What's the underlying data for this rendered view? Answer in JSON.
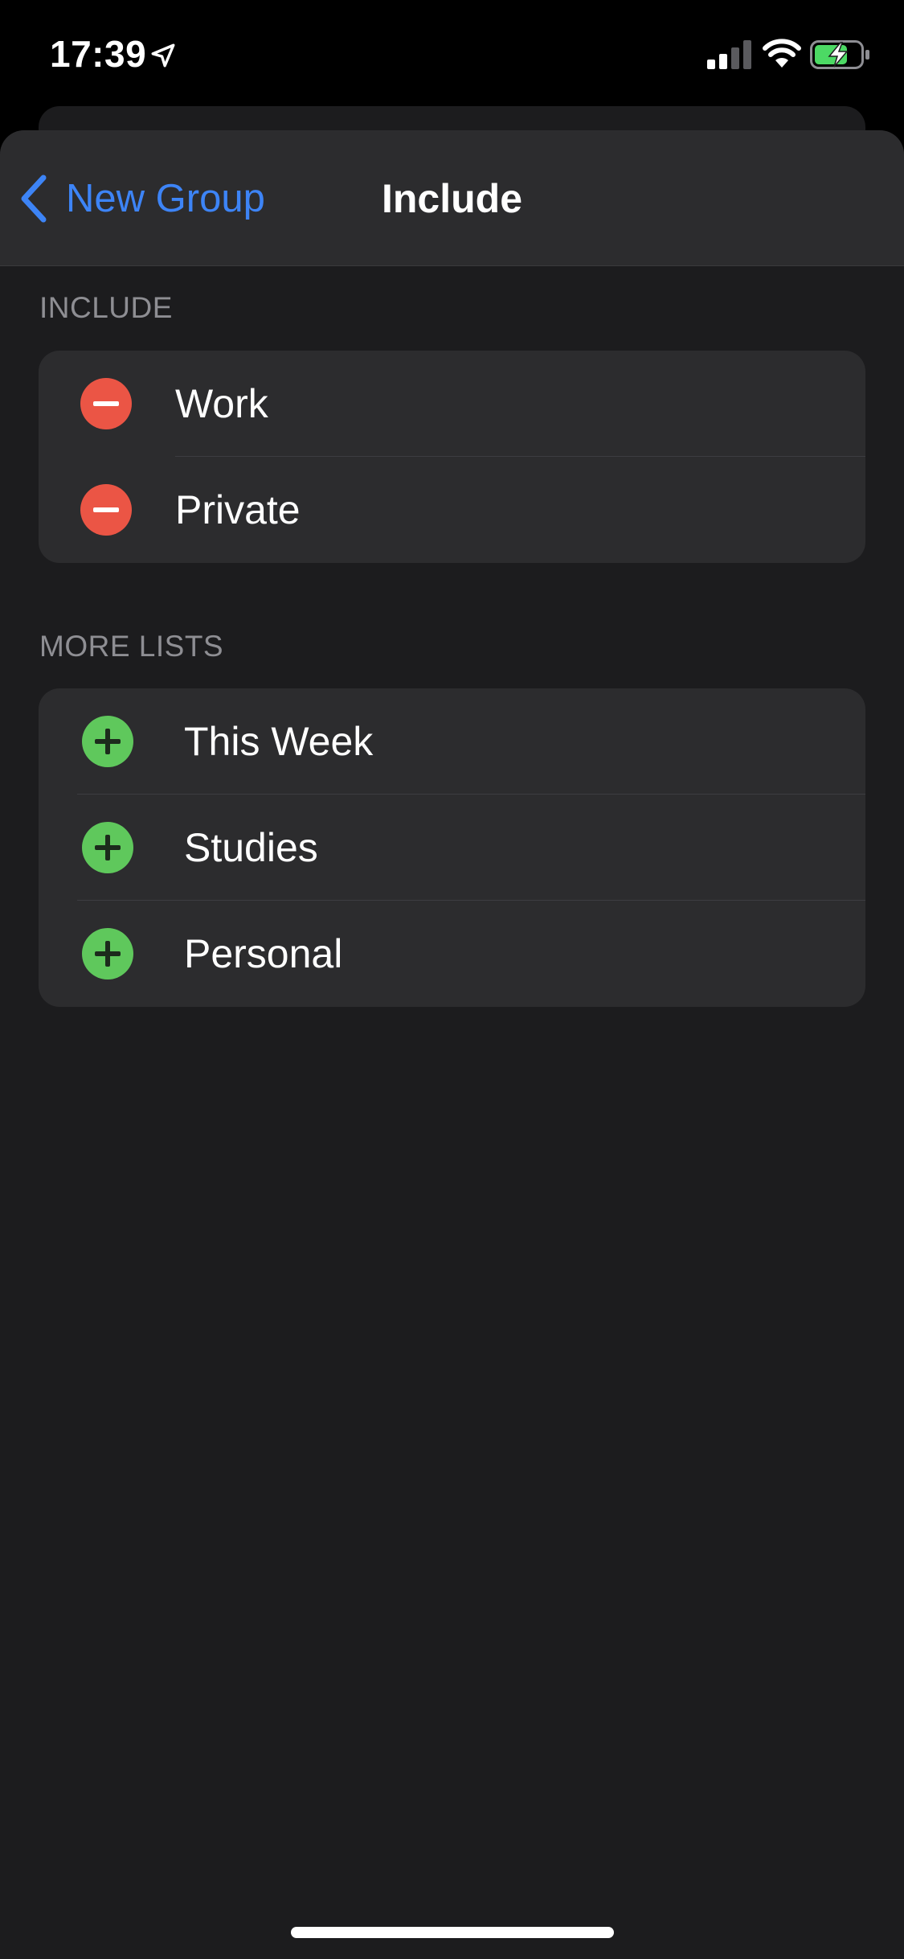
{
  "status_bar": {
    "time": "17:39",
    "icons": [
      "location-arrow-icon",
      "cellular-signal-icon",
      "wifi-icon",
      "battery-charging-icon"
    ]
  },
  "nav": {
    "back_label": "New Group",
    "title": "Include"
  },
  "include_section": {
    "header": "INCLUDE",
    "items": [
      {
        "label": "Work",
        "icon": "minus-circle-icon"
      },
      {
        "label": "Private",
        "icon": "minus-circle-icon"
      }
    ]
  },
  "more_lists_section": {
    "header": "MORE LISTS",
    "items": [
      {
        "label": "This Week",
        "icon": "plus-circle-icon"
      },
      {
        "label": "Studies",
        "icon": "plus-circle-icon"
      },
      {
        "label": "Personal",
        "icon": "plus-circle-icon"
      }
    ]
  },
  "colors": {
    "accent": "#3d84f6",
    "remove": "#eb5545",
    "add": "#5fc85c",
    "background": "#1c1c1e",
    "cell": "#2c2c2e"
  }
}
